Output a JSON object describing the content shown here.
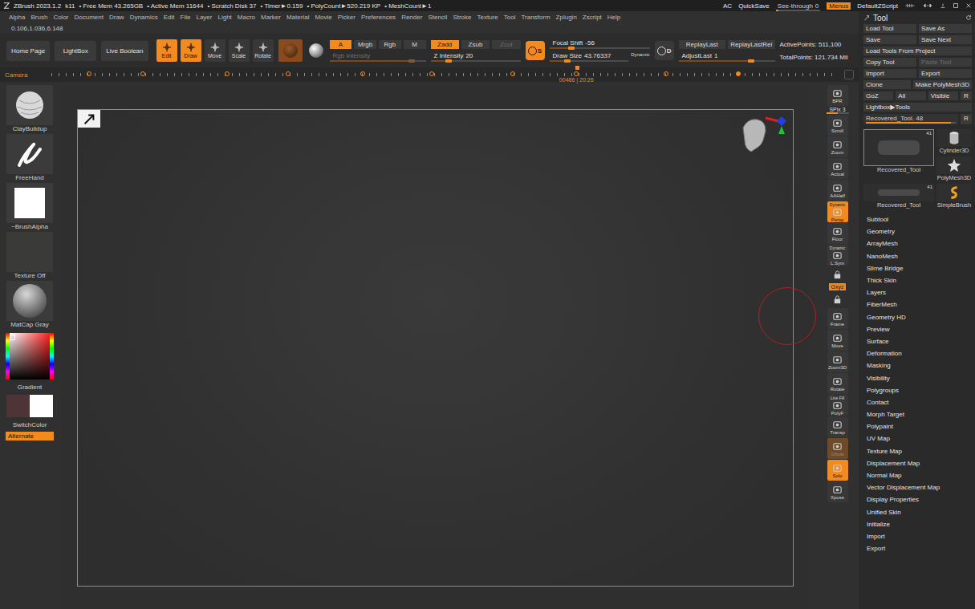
{
  "titlebar": {
    "app": "ZBrush 2023.1.2",
    "items": [
      "k11",
      "• Free Mem 43.265GB",
      "• Active Mem 11644",
      "• Scratch Disk 37",
      "• Timer►0.159",
      "• PolyCount►520.219 KP",
      "• MeshCount►1"
    ],
    "right": [
      "AC",
      "QuickSave"
    ],
    "see_through": {
      "label": "See-through",
      "value": "0",
      "level": 0
    },
    "menus": {
      "label": "Menus",
      "on": true
    },
    "script": "DefaultZScript"
  },
  "menubar": [
    "Alpha",
    "Brush",
    "Color",
    "Document",
    "Draw",
    "Dynamics",
    "Edit",
    "File",
    "Layer",
    "Light",
    "Macro",
    "Marker",
    "Material",
    "Movie",
    "Picker",
    "Preferences",
    "Render",
    "Stencil",
    "Stroke",
    "Texture",
    "Tool",
    "Transform",
    "Zplugin",
    "Zscript",
    "Help"
  ],
  "coords": "0.106,1.036,6.148",
  "shelf": {
    "nav": [
      "Home Page",
      "LightBox",
      "Live Boolean"
    ],
    "transform": [
      {
        "label": "Edit",
        "selected": true
      },
      {
        "label": "Draw",
        "selected": true
      },
      {
        "label": "Move",
        "selected": false
      },
      {
        "label": "Scale",
        "selected": false
      },
      {
        "label": "Rotate",
        "selected": false
      }
    ],
    "color_modes": [
      {
        "label": "A",
        "selected": true
      },
      {
        "label": "Mrgb",
        "selected": false
      },
      {
        "label": "Rgb",
        "selected": false
      },
      {
        "label": "M",
        "selected": false
      }
    ],
    "rgb_intensity": {
      "label": "Rgb Intensity",
      "value": "",
      "level": 0.85,
      "disabled": true
    },
    "z_modes": [
      {
        "label": "Zadd",
        "selected": true,
        "disabled": false
      },
      {
        "label": "Zsub",
        "selected": false,
        "disabled": false
      },
      {
        "label": "Zcut",
        "selected": false,
        "disabled": true
      }
    ],
    "z_intensity": {
      "label": "Z Intensity",
      "value": "20",
      "level": 0.2
    },
    "focal_toggle": {
      "label": "S",
      "on": true
    },
    "focal_shift": {
      "label": "Focal Shift",
      "value": "-56",
      "level": 0.22
    },
    "draw_size": {
      "label": "Draw Size",
      "value": "43.76337",
      "level": 0.23
    },
    "dynamic": "Dynamic",
    "d_toggle": {
      "label": "D",
      "on": false
    },
    "replay": [
      "ReplayLast",
      "ReplayLastRel"
    ],
    "adjust_last": {
      "label": "AdjustLast",
      "value": "1",
      "level": 0.75
    },
    "stats": [
      "ActivePoints: 511,100",
      "TotalPoints: 121.734 Mil"
    ]
  },
  "timeline": {
    "label": "Camera",
    "frame": "00486",
    "time": "20:26",
    "cursor": 0.672,
    "keyframes": [
      {
        "pos": 0.048,
        "selected": false
      },
      {
        "pos": 0.117,
        "selected": false
      },
      {
        "pos": 0.224,
        "selected": false
      },
      {
        "pos": 0.302,
        "selected": false
      },
      {
        "pos": 0.398,
        "selected": false
      },
      {
        "pos": 0.486,
        "selected": false
      },
      {
        "pos": 0.589,
        "selected": false
      },
      {
        "pos": 0.67,
        "selected": false
      },
      {
        "pos": 0.785,
        "selected": false
      },
      {
        "pos": 0.877,
        "selected": true
      }
    ]
  },
  "left_shelf": {
    "brush": "ClayBuildup",
    "stroke": "FreeHand",
    "alpha": "~BrushAlpha",
    "texture": "Texture Off",
    "material": "MatCap Gray",
    "gradient": "Gradient",
    "switch_color": "SwitchColor",
    "alternate": {
      "label": "Alternate",
      "on": true
    },
    "swatches": [
      {
        "name": "main",
        "color": "#4e3436"
      },
      {
        "name": "secondary",
        "color": "#ffffff"
      }
    ]
  },
  "right_shelf": [
    {
      "label": "BPR",
      "kind": "button",
      "on": false
    },
    {
      "label": "SPix 3",
      "kind": "slider",
      "level": 0.5
    },
    {
      "label": "Scroll",
      "kind": "button",
      "on": false
    },
    {
      "label": "Zoom",
      "kind": "button",
      "on": false
    },
    {
      "label": "Actual",
      "kind": "button",
      "on": false
    },
    {
      "label": "AAHalf",
      "kind": "button",
      "on": false
    },
    {
      "label": "Persp",
      "kind": "button",
      "on": true,
      "note": "Dynamic"
    },
    {
      "label": "Floor",
      "kind": "button",
      "on": false
    },
    {
      "label": "L.Sym",
      "kind": "button",
      "on": false,
      "note": "Dynamic"
    },
    {
      "label": "",
      "kind": "icon",
      "on": false
    },
    {
      "label": "Gxyz",
      "kind": "toggle",
      "on": true
    },
    {
      "label": "",
      "kind": "icon",
      "on": false
    },
    {
      "label": "Frame",
      "kind": "button",
      "on": false
    },
    {
      "label": "Move",
      "kind": "button",
      "on": false
    },
    {
      "label": "Zoom3D",
      "kind": "button",
      "on": false
    },
    {
      "label": "Rotate",
      "kind": "button",
      "on": false
    },
    {
      "label": "PolyF",
      "kind": "button",
      "on": false,
      "note": "Line Fill"
    },
    {
      "label": "Transp",
      "kind": "button",
      "on": false
    },
    {
      "label": "Ghost",
      "kind": "button",
      "on": true,
      "disabled": true
    },
    {
      "label": "Solo",
      "kind": "button",
      "on": true
    },
    {
      "label": "Xpose",
      "kind": "button",
      "on": false
    }
  ],
  "tool_panel": {
    "title": "Tool",
    "button_rows": [
      [
        {
          "label": "Load Tool",
          "disabled": false
        },
        {
          "label": "Save As",
          "disabled": false
        }
      ],
      [
        {
          "label": "Save",
          "disabled": false
        },
        {
          "label": "Save Next",
          "disabled": false
        }
      ],
      [
        {
          "label": "Load Tools From Project",
          "disabled": false
        }
      ],
      [
        {
          "label": "Copy Tool",
          "disabled": false
        },
        {
          "label": "Paste Tool",
          "disabled": true
        }
      ],
      [
        {
          "label": "Import",
          "disabled": false
        },
        {
          "label": "Export",
          "disabled": false
        }
      ],
      [
        {
          "label": "Clone",
          "disabled": false
        },
        {
          "label": "Make PolyMesh3D",
          "disabled": false
        }
      ],
      [
        {
          "label": "GoZ",
          "disabled": false
        },
        {
          "label": "All",
          "disabled": false
        },
        {
          "label": "Visible",
          "disabled": false
        },
        {
          "label": "R",
          "disabled": false
        }
      ],
      [
        {
          "label": "Lightbox▶Tools",
          "disabled": false
        }
      ]
    ],
    "tool_slider": {
      "label": "Recovered_Tool. 48",
      "level": 0.95,
      "button": "R"
    },
    "tools": [
      {
        "name": "Recovered_Tool",
        "badge": "41",
        "selected": true,
        "big": true
      },
      {
        "name": "Cylinder3D",
        "badge": "",
        "selected": false,
        "big": false
      },
      {
        "name": "PolyMesh3D",
        "badge": "",
        "selected": false,
        "big": false
      },
      {
        "name": "Recovered_Tool",
        "badge": "41",
        "selected": false,
        "big": false
      },
      {
        "name": "SimpleBrush",
        "badge": "",
        "selected": false,
        "big": false
      }
    ],
    "menu": [
      "Subtool",
      "Geometry",
      "ArrayMesh",
      "NanoMesh",
      "Slime Bridge",
      "Thick Skin",
      "Layers",
      "FiberMesh",
      "Geometry HD",
      "Preview",
      "Surface",
      "Deformation",
      "Masking",
      "Visibility",
      "Polygroups",
      "Contact",
      "Morph Target",
      "Polypaint",
      "UV Map",
      "Texture Map",
      "Displacement Map",
      "Normal Map",
      "Vector Displacement Map",
      "Display Properties",
      "Unified Skin",
      "Initialize",
      "Import",
      "Export"
    ]
  }
}
